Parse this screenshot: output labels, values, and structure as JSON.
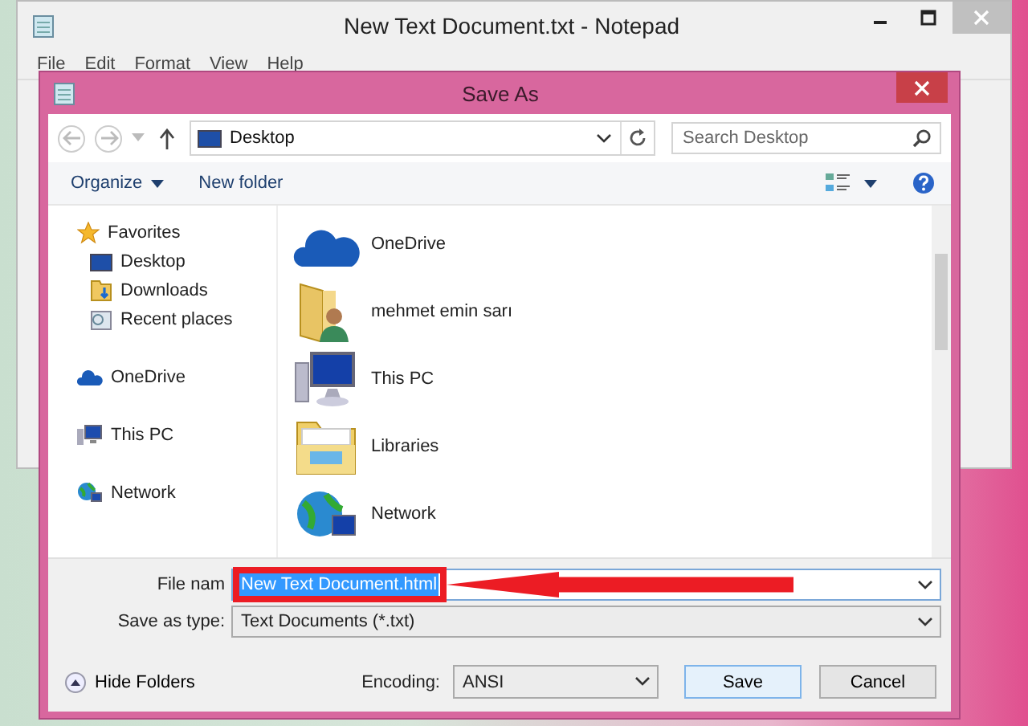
{
  "notepad": {
    "title": "New Text Document.txt - Notepad",
    "menu": [
      "File",
      "Edit",
      "Format",
      "View",
      "Help"
    ]
  },
  "dialog": {
    "title": "Save As",
    "address": {
      "location": "Desktop"
    },
    "search": {
      "placeholder": "Search Desktop"
    },
    "commands": [
      {
        "label": "Organize",
        "kind": "dropdown"
      },
      {
        "label": "New folder",
        "kind": "plain"
      }
    ],
    "sidebar": [
      {
        "label": "Favorites",
        "kind": "star",
        "children": [
          {
            "label": "Desktop",
            "kind": "desktop"
          },
          {
            "label": "Downloads",
            "kind": "downloads"
          },
          {
            "label": "Recent places",
            "kind": "recent"
          }
        ]
      },
      {
        "label": "OneDrive",
        "kind": "cloud"
      },
      {
        "label": "This PC",
        "kind": "pc"
      },
      {
        "label": "Network",
        "kind": "network"
      }
    ],
    "items": [
      {
        "label": "OneDrive",
        "kind": "cloud"
      },
      {
        "label": "mehmet emin sarı",
        "kind": "userfolder"
      },
      {
        "label": "This PC",
        "kind": "pc"
      },
      {
        "label": "Libraries",
        "kind": "libraries"
      },
      {
        "label": "Network",
        "kind": "network"
      }
    ],
    "file_name": {
      "label": "File nam",
      "value": "New Text Document.html",
      "text_selected": true
    },
    "save_as_type": {
      "label": "Save as type:",
      "value": "Text Documents (*.txt)"
    },
    "hide_folders": "Hide Folders",
    "encoding": {
      "label": "Encoding:",
      "value": "ANSI"
    },
    "buttons": [
      {
        "label": "Save",
        "default": true
      },
      {
        "label": "Cancel",
        "default": false
      }
    ]
  }
}
